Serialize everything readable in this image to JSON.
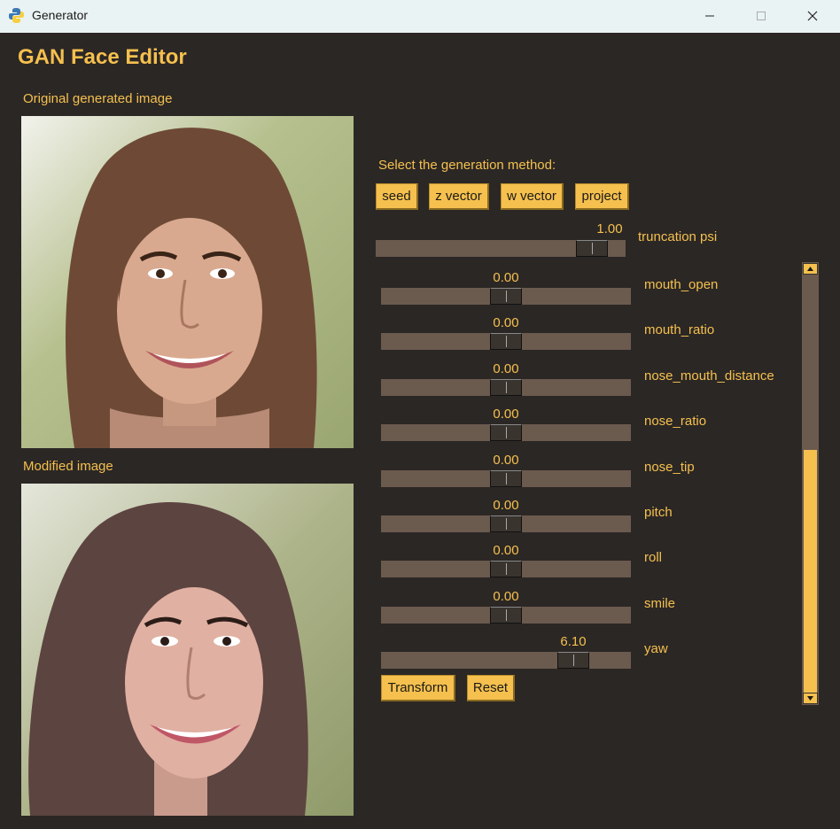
{
  "window": {
    "title": "Generator"
  },
  "app_title": "GAN Face Editor",
  "original_label": "Original generated image",
  "modified_label": "Modified image",
  "method_label": "Select the generation method:",
  "method_buttons": [
    "seed",
    "z vector",
    "w vector",
    "project"
  ],
  "truncation": {
    "name": "truncation psi",
    "value": "1.00",
    "level": 0.92
  },
  "sliders": [
    {
      "name": "mouth_open",
      "value": "0.00",
      "level": 0.5
    },
    {
      "name": "mouth_ratio",
      "value": "0.00",
      "level": 0.5
    },
    {
      "name": "nose_mouth_distance",
      "value": "0.00",
      "level": 0.5
    },
    {
      "name": "nose_ratio",
      "value": "0.00",
      "level": 0.5
    },
    {
      "name": "nose_tip",
      "value": "0.00",
      "level": 0.5
    },
    {
      "name": "pitch",
      "value": "0.00",
      "level": 0.5
    },
    {
      "name": "roll",
      "value": "0.00",
      "level": 0.5
    },
    {
      "name": "smile",
      "value": "0.00",
      "level": 0.5
    },
    {
      "name": "yaw",
      "value": "6.10",
      "level": 0.81
    }
  ],
  "actions": {
    "transform": "Transform",
    "reset": "Reset"
  },
  "scroll": {
    "position": 0.42
  },
  "colors": {
    "accent": "#f5c04e",
    "background": "#2b2725",
    "track": "#6b5a4e"
  }
}
